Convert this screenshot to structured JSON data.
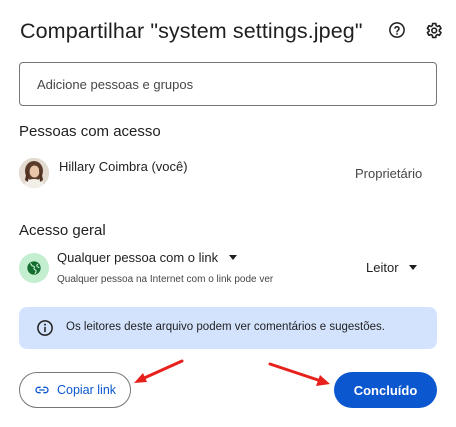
{
  "dialog": {
    "title": "Compartilhar \"system settings.jpeg\"",
    "help_icon": "help-circle-icon",
    "settings_icon": "gear-icon"
  },
  "share_input": {
    "placeholder": "Adicione pessoas e grupos"
  },
  "people_section": {
    "title": "Pessoas com acesso",
    "people": [
      {
        "name": "Hillary Coimbra (você)",
        "role": "Proprietário"
      }
    ]
  },
  "general_access": {
    "title": "Acesso geral",
    "access_label": "Qualquer pessoa com o link",
    "access_description": "Qualquer pessoa na Internet com o link pode ver",
    "role": "Leitor",
    "globe_icon": "globe-icon"
  },
  "info_banner": {
    "icon": "info-icon",
    "text": "Os leitores deste arquivo podem ver comentários e sugestões."
  },
  "footer": {
    "copy_link_label": "Copiar link",
    "done_label": "Concluído"
  },
  "colors": {
    "primary": "#0b57d0",
    "info_bg": "#d3e3fd",
    "globe_bg": "#c4eed0",
    "annotation_arrow": "#e8201c"
  }
}
